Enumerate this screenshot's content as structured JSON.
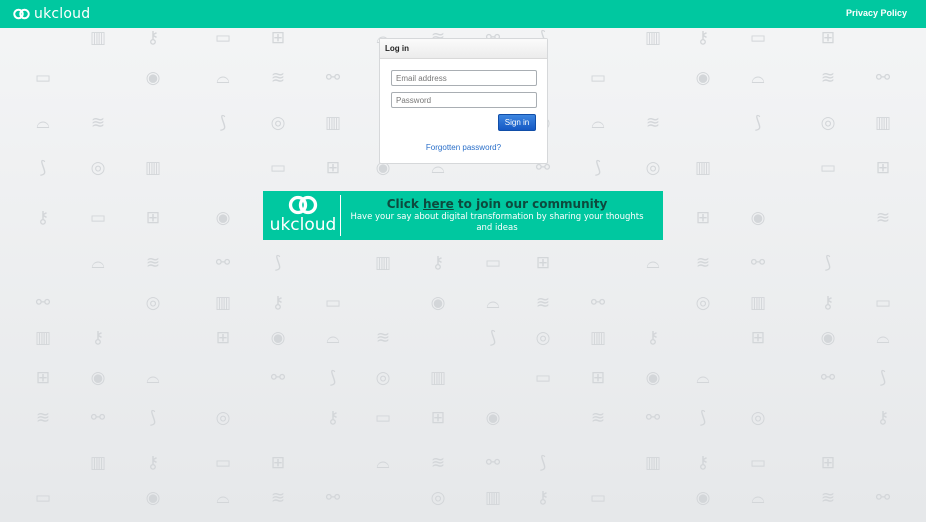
{
  "header": {
    "logo_text": "ukcloud",
    "privacy_link": "Privacy Policy",
    "accent_color": "#00c8a0"
  },
  "login": {
    "title": "Log in",
    "email_placeholder": "Email address",
    "password_placeholder": "Password",
    "signin_label": "Sign in",
    "forgot_link": "Forgotten password?"
  },
  "banner": {
    "logo_text": "ukcloud",
    "headline_prefix": "Click ",
    "headline_link": "here",
    "headline_suffix": " to join our community",
    "subtext": "Have your say about digital transformation by sharing your thoughts and ideas"
  },
  "background": {
    "icon_names": [
      "globe-icon",
      "building-icon",
      "key-icon",
      "laptop-icon",
      "medkit-icon",
      "target-icon",
      "car-icon",
      "chart-icon",
      "bicycle-icon",
      "dna-icon"
    ]
  }
}
